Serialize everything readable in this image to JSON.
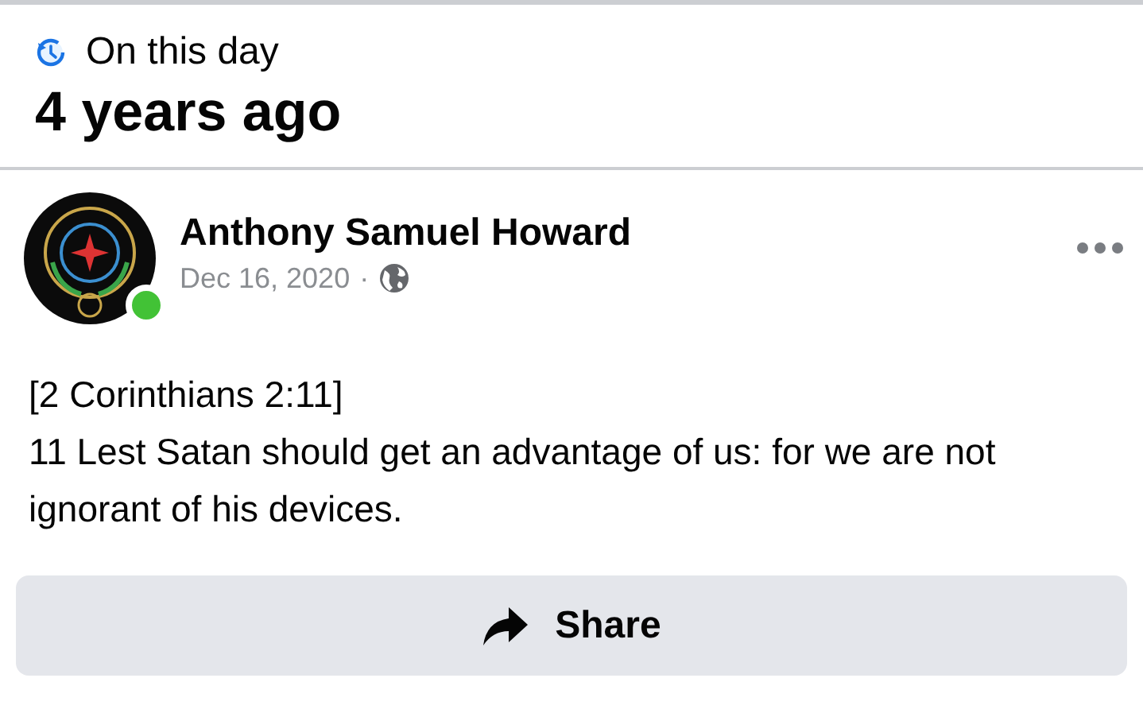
{
  "memory_header": {
    "label": "On this day",
    "title": "4 years ago"
  },
  "post": {
    "author": "Anthony Samuel Howard",
    "online": true,
    "date": "Dec 16, 2020",
    "separator": "·",
    "body": [
      "[2 Corinthians 2:11]",
      "11 Lest Satan should get an advantage of us: for we are not ignorant of his devices."
    ]
  },
  "share_button": {
    "label": "Share"
  }
}
